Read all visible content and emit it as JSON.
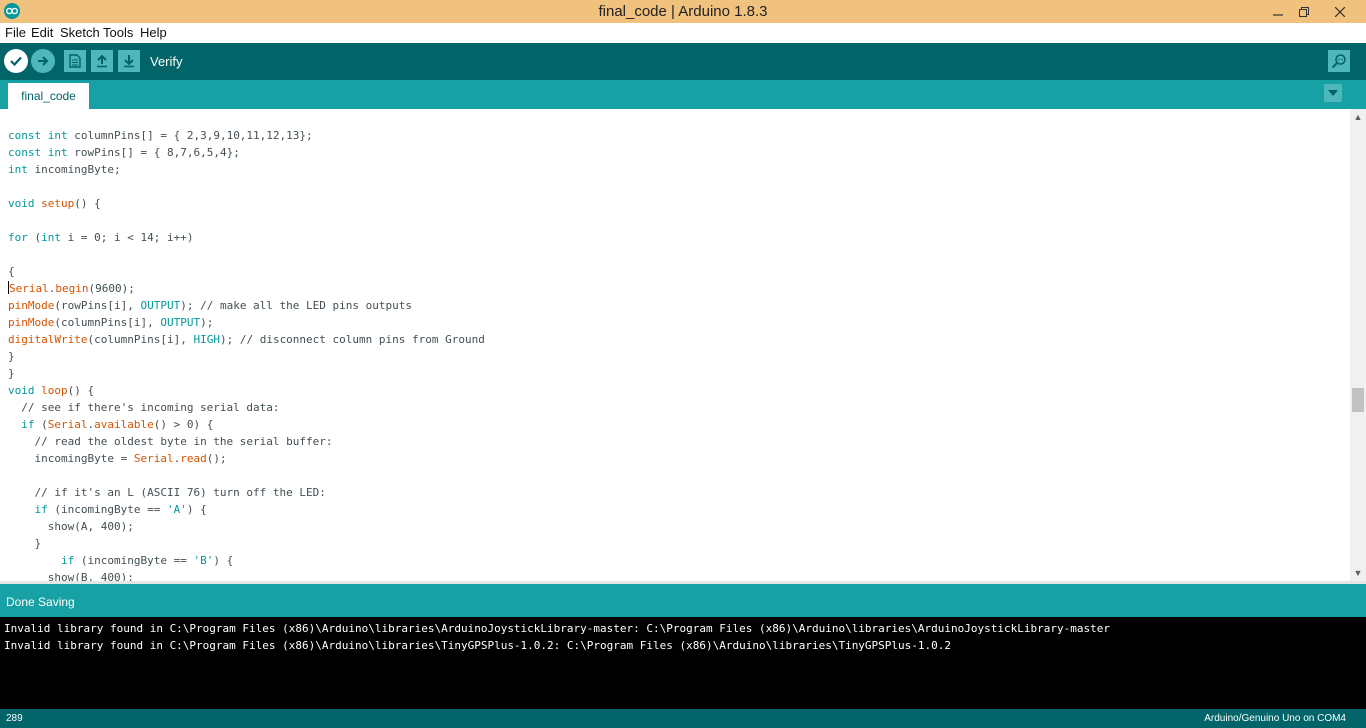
{
  "window": {
    "title": "final_code | Arduino 1.8.3"
  },
  "menu": [
    "File",
    "Edit",
    "Sketch",
    "Tools",
    "Help"
  ],
  "toolbar": {
    "hover_label": "Verify"
  },
  "tabs": [
    {
      "label": "final_code"
    }
  ],
  "code": [
    [
      [
        "kw",
        "const"
      ],
      [
        "t",
        " "
      ],
      [
        "kw",
        "int"
      ],
      [
        "t",
        " columnPins[] = { 2,3,9,10,11,12,13};"
      ]
    ],
    [
      [
        "kw",
        "const"
      ],
      [
        "t",
        " "
      ],
      [
        "kw",
        "int"
      ],
      [
        "t",
        " rowPins[] = { 8,7,6,5,4};"
      ]
    ],
    [
      [
        "kw",
        "int"
      ],
      [
        "t",
        " incomingByte;"
      ]
    ],
    [],
    [
      [
        "kw",
        "void"
      ],
      [
        "t",
        " "
      ],
      [
        "fn",
        "setup"
      ],
      [
        "t",
        "() {"
      ]
    ],
    [],
    [
      [
        "kw",
        "for"
      ],
      [
        "t",
        " ("
      ],
      [
        "kw",
        "int"
      ],
      [
        "t",
        " i = 0; i < 14; i++)"
      ]
    ],
    [],
    [
      [
        "t",
        "{"
      ]
    ],
    [
      [
        "caret",
        ""
      ],
      [
        "fn",
        "Serial"
      ],
      [
        "t",
        "."
      ],
      [
        "fn",
        "begin"
      ],
      [
        "t",
        "(9600);"
      ]
    ],
    [
      [
        "fn",
        "pinMode"
      ],
      [
        "t",
        "(rowPins[i], "
      ],
      [
        "lit",
        "OUTPUT"
      ],
      [
        "t",
        "); "
      ],
      [
        "cm",
        "// make all the LED pins outputs"
      ]
    ],
    [
      [
        "fn",
        "pinMode"
      ],
      [
        "t",
        "(columnPins[i], "
      ],
      [
        "lit",
        "OUTPUT"
      ],
      [
        "t",
        ");"
      ]
    ],
    [
      [
        "fn",
        "digitalWrite"
      ],
      [
        "t",
        "(columnPins[i], "
      ],
      [
        "lit",
        "HIGH"
      ],
      [
        "t",
        "); "
      ],
      [
        "cm",
        "// disconnect column pins from Ground"
      ]
    ],
    [
      [
        "t",
        "}"
      ]
    ],
    [
      [
        "t",
        "}"
      ]
    ],
    [
      [
        "kw",
        "void"
      ],
      [
        "t",
        " "
      ],
      [
        "fn",
        "loop"
      ],
      [
        "t",
        "() {"
      ]
    ],
    [
      [
        "t",
        "  "
      ],
      [
        "cm",
        "// see if there's incoming serial data:"
      ]
    ],
    [
      [
        "t",
        "  "
      ],
      [
        "kw",
        "if"
      ],
      [
        "t",
        " ("
      ],
      [
        "fn",
        "Serial"
      ],
      [
        "t",
        "."
      ],
      [
        "fn",
        "available"
      ],
      [
        "t",
        "() > 0) {"
      ]
    ],
    [
      [
        "t",
        "    "
      ],
      [
        "cm",
        "// read the oldest byte in the serial buffer:"
      ]
    ],
    [
      [
        "t",
        "    incomingByte = "
      ],
      [
        "fn",
        "Serial"
      ],
      [
        "t",
        "."
      ],
      [
        "fn",
        "read"
      ],
      [
        "t",
        "();"
      ]
    ],
    [],
    [
      [
        "t",
        "    "
      ],
      [
        "cm",
        "// if it's an L (ASCII 76) turn off the LED:"
      ]
    ],
    [
      [
        "t",
        "    "
      ],
      [
        "kw",
        "if"
      ],
      [
        "t",
        " (incomingByte == "
      ],
      [
        "lit",
        "'A'"
      ],
      [
        "t",
        ") {"
      ]
    ],
    [
      [
        "t",
        "      show(A, 400);"
      ]
    ],
    [
      [
        "t",
        "    }"
      ]
    ],
    [
      [
        "t",
        "        "
      ],
      [
        "kw",
        "if"
      ],
      [
        "t",
        " (incomingByte == "
      ],
      [
        "lit",
        "'B'"
      ],
      [
        "t",
        ") {"
      ]
    ],
    [
      [
        "t",
        "      show(B, 400);"
      ]
    ]
  ],
  "status": {
    "message": "Done Saving"
  },
  "console": [
    "Invalid library found in C:\\Program Files (x86)\\Arduino\\libraries\\ArduinoJoystickLibrary-master: C:\\Program Files (x86)\\Arduino\\libraries\\ArduinoJoystickLibrary-master",
    "Invalid library found in C:\\Program Files (x86)\\Arduino\\libraries\\TinyGPSPlus-1.0.2: C:\\Program Files (x86)\\Arduino\\libraries\\TinyGPSPlus-1.0.2"
  ],
  "footer": {
    "line_number": "289",
    "board": "Arduino/Genuino Uno on COM4"
  },
  "colors": {
    "toolbar": "#006468",
    "tabbar": "#17a1a5",
    "titlebar": "#f1c27d",
    "keyword": "#00979c",
    "function": "#d35400"
  }
}
